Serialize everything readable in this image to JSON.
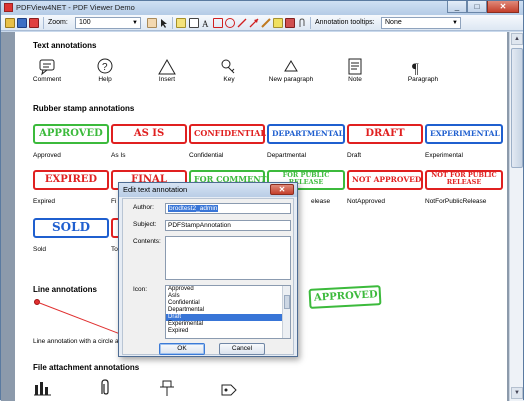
{
  "window": {
    "title": "PDFView4NET - PDF Viewer Demo",
    "minimize": "_",
    "maximize": "□",
    "close": "✕"
  },
  "toolbar": {
    "zoom_label": "Zoom:",
    "zoom_value": "100",
    "tooltips_label": "Annotation tooltips:",
    "tooltips_value": "None"
  },
  "page": {
    "text_annotations": {
      "title": "Text annotations",
      "items": [
        "Comment",
        "Help",
        "Insert",
        "Key",
        "New paragraph",
        "Note",
        "Paragraph"
      ]
    },
    "rubber_stamps": {
      "title": "Rubber stamp annotations",
      "row1": [
        {
          "stamp": "APPROVED",
          "label": "Approved",
          "color": "#3cba3c"
        },
        {
          "stamp": "AS IS",
          "label": "As Is",
          "color": "#e02020"
        },
        {
          "stamp": "CONFIDENTIAL",
          "label": "Confidential",
          "color": "#e02020"
        },
        {
          "stamp": "DEPARTMENTAL",
          "label": "Departmental",
          "color": "#1f5fcf"
        },
        {
          "stamp": "DRAFT",
          "label": "Draft",
          "color": "#e02020"
        },
        {
          "stamp": "EXPERIMENTAL",
          "label": "Experimental",
          "color": "#1f5fcf"
        }
      ],
      "row2": [
        {
          "stamp": "EXPIRED",
          "label": "Expired",
          "color": "#e02020"
        },
        {
          "stamp": "FINAL",
          "label": "Fi",
          "color": "#e02020"
        },
        {
          "stamp": "FOR COMMENT",
          "label": "",
          "color": "#3cba3c"
        },
        {
          "stamp": "FOR PUBLIC RELEASE",
          "label": "elease",
          "color": "#3cba3c"
        },
        {
          "stamp": "NOT APPROVED",
          "label": "NotApproved",
          "color": "#e02020"
        },
        {
          "stamp": "NOT FOR PUBLIC RELEASE",
          "label": "NotForPublicRelease",
          "color": "#e02020"
        }
      ],
      "row3": [
        {
          "stamp": "SOLD",
          "label": "Sold",
          "color": "#1f5fcf"
        },
        {
          "stamp": "",
          "label": "To",
          "color": "#e02020"
        }
      ],
      "floating_stamp": "APPROVED"
    },
    "line_annotations": {
      "title": "Line annotations",
      "caption": "Line annotation with a circle an"
    },
    "file_attachments": {
      "title": "File attachment annotations"
    }
  },
  "dialog": {
    "title": "Edit text annotation",
    "close": "✕",
    "author_label": "Author:",
    "author_value": "brodtest2_admin",
    "subject_label": "Subject:",
    "subject_value": "PDFStampAnnotation",
    "contents_label": "Contents:",
    "icon_label": "Icon:",
    "icon_options": [
      "Approved",
      "AsIs",
      "Confidential",
      "Departmental",
      "Draft",
      "Experimental",
      "Expired"
    ],
    "icon_selected": "Draft",
    "ok_label": "OK",
    "cancel_label": "Cancel"
  }
}
